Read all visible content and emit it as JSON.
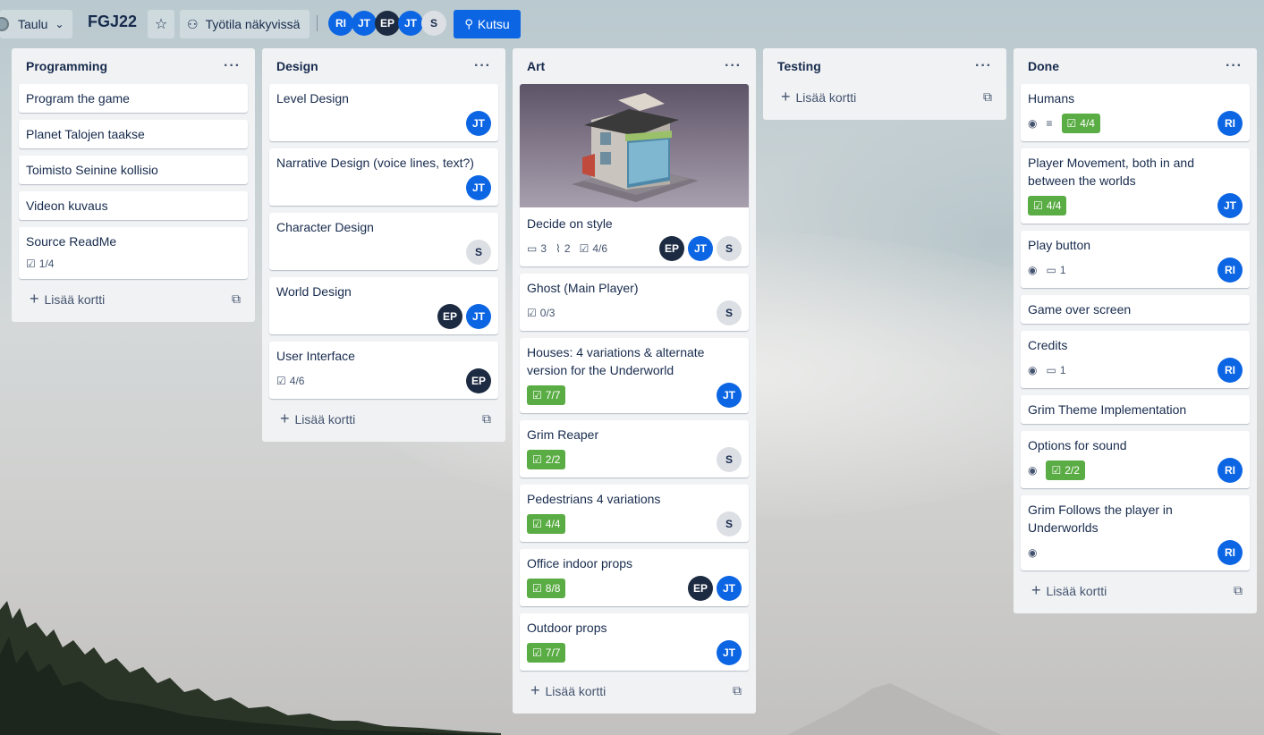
{
  "header": {
    "view_label": "Taulu",
    "board_title": "FGJ22",
    "visibility_label": "Työtila näkyvissä",
    "invite_label": "Kutsu",
    "members": [
      "RI",
      "JT",
      "EP",
      "JT",
      "S"
    ]
  },
  "add_card_label": "Lisää kortti",
  "lists": [
    {
      "title": "Programming",
      "cards": [
        {
          "title": "Program the game"
        },
        {
          "title": "Planet Talojen taakse"
        },
        {
          "title": "Toimisto Seinine kollisio"
        },
        {
          "title": "Videon kuvaus"
        },
        {
          "title": "Source ReadMe",
          "checklist": "1/4"
        }
      ]
    },
    {
      "title": "Design",
      "cards": [
        {
          "title": "Level Design",
          "members": [
            "JT"
          ]
        },
        {
          "title": "Narrative Design (voice lines, text?)",
          "members": [
            "JT"
          ]
        },
        {
          "title": "Character Design",
          "members": [
            "S"
          ]
        },
        {
          "title": "World Design",
          "members": [
            "EP",
            "JT"
          ]
        },
        {
          "title": "User Interface",
          "checklist": "4/6",
          "members": [
            "EP"
          ]
        }
      ]
    },
    {
      "title": "Art",
      "cards": [
        {
          "title": "Decide on style",
          "comments": "3",
          "attachments": "2",
          "checklist": "4/6",
          "members": [
            "EP",
            "JT",
            "S"
          ]
        },
        {
          "title": "Ghost (Main Player)",
          "checklist": "0/3",
          "members": [
            "S"
          ]
        },
        {
          "title": "Houses: 4 variations & alternate version for the Underworld",
          "checklist_done": "7/7",
          "members": [
            "JT"
          ]
        },
        {
          "title": "Grim Reaper",
          "checklist_done": "2/2",
          "members": [
            "S"
          ]
        },
        {
          "title": "Pedestrians 4 variations",
          "checklist_done": "4/4",
          "members": [
            "S"
          ]
        },
        {
          "title": "Office indoor props",
          "checklist_done": "8/8",
          "members": [
            "EP",
            "JT"
          ]
        },
        {
          "title": "Outdoor props",
          "checklist_done": "7/7",
          "members": [
            "JT"
          ]
        }
      ]
    },
    {
      "title": "Testing",
      "cards": []
    },
    {
      "title": "Done",
      "cards": [
        {
          "title": "Humans",
          "checklist_done": "4/4",
          "members": [
            "RI"
          ]
        },
        {
          "title": "Player Movement, both in and between the worlds",
          "checklist_done": "4/4",
          "members": [
            "JT"
          ]
        },
        {
          "title": "Play button",
          "comments": "1",
          "members": [
            "RI"
          ]
        },
        {
          "title": "Game over screen"
        },
        {
          "title": "Credits",
          "comments": "1",
          "members": [
            "RI"
          ]
        },
        {
          "title": "Grim Theme Implementation"
        },
        {
          "title": "Options for sound",
          "checklist_done": "2/2",
          "members": [
            "RI"
          ]
        },
        {
          "title": "Grim Follows the player in Underworlds",
          "members": [
            "RI"
          ]
        }
      ]
    }
  ],
  "colors": {
    "accent": "#0c66e4",
    "checklist_complete": "#5aac44",
    "list_bg": "#f1f2f4"
  }
}
